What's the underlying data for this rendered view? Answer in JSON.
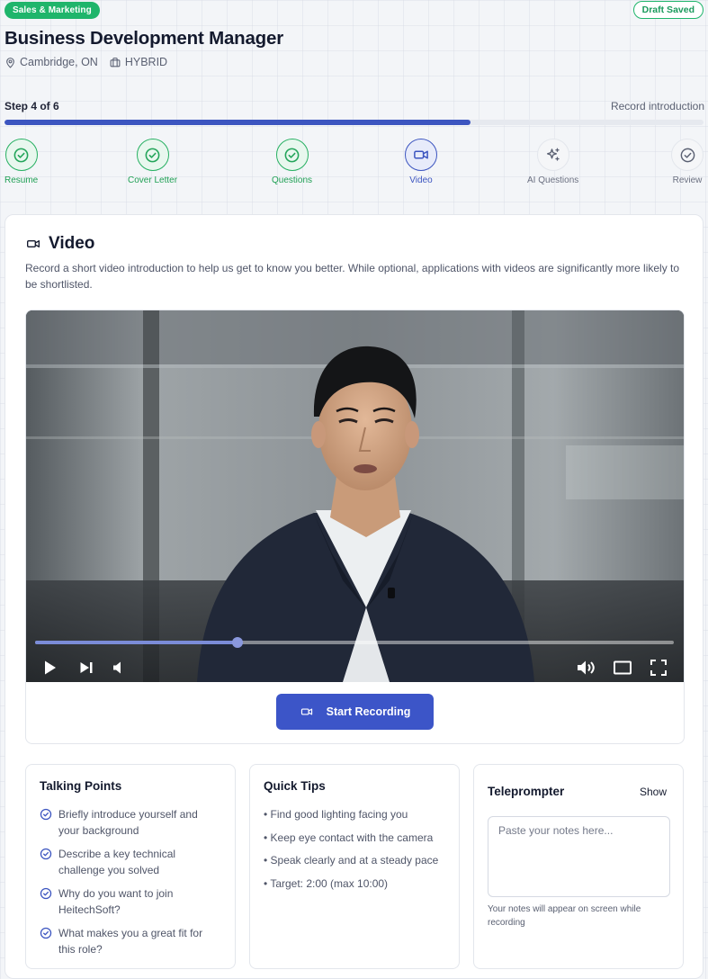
{
  "header": {
    "category_badge": "Sales & Marketing",
    "draft_status": "Draft Saved",
    "job_title": "Business Development Manager",
    "location": "Cambridge, ON",
    "work_type": "HYBRID"
  },
  "progress": {
    "step_label": "Step 4 of 6",
    "step_description": "Record introduction",
    "fraction": 0.667
  },
  "steps": [
    {
      "label": "Resume",
      "state": "complete"
    },
    {
      "label": "Cover Letter",
      "state": "complete"
    },
    {
      "label": "Questions",
      "state": "complete"
    },
    {
      "label": "Video",
      "state": "active"
    },
    {
      "label": "AI Questions",
      "state": "pending"
    },
    {
      "label": "Review",
      "state": "pending"
    }
  ],
  "video_section": {
    "title": "Video",
    "description": "Record a short video introduction to help us get to know you better. While optional, applications with videos are significantly more likely to be shortlisted.",
    "playback_fraction": 0.317,
    "record_button": "Start Recording"
  },
  "talking_points": {
    "title": "Talking Points",
    "items": [
      "Briefly introduce yourself and your background",
      "Describe a key technical challenge you solved",
      "Why do you want to join HeitechSoft?",
      "What makes you a great fit for this role?"
    ]
  },
  "quick_tips": {
    "title": "Quick Tips",
    "items": [
      "• Find good lighting facing you",
      "• Keep eye contact with the camera",
      "• Speak clearly and at a steady pace",
      "• Target: 2:00 (max 10:00)"
    ]
  },
  "teleprompter": {
    "title": "Teleprompter",
    "toggle_label": "Show",
    "placeholder": "Paste your notes here...",
    "hint": "Your notes will appear on screen while recording"
  },
  "colors": {
    "accent": "#3c55c8",
    "success": "#1fb56b",
    "text": "#141a2e"
  },
  "icons": {
    "location": "map-pin-icon",
    "work_type": "briefcase-icon",
    "step_complete": "check-circle-icon",
    "step_video": "video-camera-icon",
    "step_ai": "sparkles-icon",
    "play": "play-icon",
    "next": "skip-next-icon",
    "mute": "volume-low-icon",
    "volume": "volume-high-icon",
    "theater": "theater-mode-icon",
    "fullscreen": "fullscreen-icon"
  }
}
